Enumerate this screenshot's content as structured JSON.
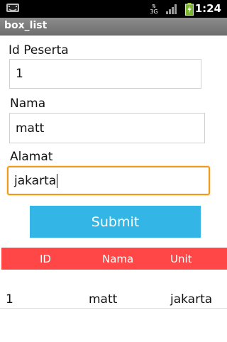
{
  "status_bar": {
    "time": "1:24",
    "network_label": "3G"
  },
  "title_bar": {
    "title": "box_list"
  },
  "form": {
    "id_label": "Id Peserta",
    "id_value": "1",
    "nama_label": "Nama",
    "nama_value": "matt",
    "alamat_label": "Alamat",
    "alamat_value": "jakarta",
    "submit_label": "Submit"
  },
  "table": {
    "headers": [
      "ID",
      "Nama",
      "Unit"
    ],
    "rows": [
      [
        "1",
        "matt",
        "jakarta"
      ]
    ]
  },
  "colors": {
    "accent_blue": "#33b5e5",
    "header_red": "#ff4747",
    "focus_orange": "#f09a1a"
  }
}
